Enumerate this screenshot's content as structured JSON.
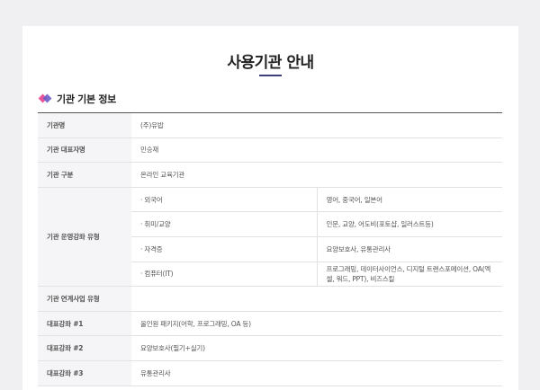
{
  "page": {
    "title": "사용기관 안내"
  },
  "section": {
    "title": "기관 기본 정보"
  },
  "rows": {
    "name": {
      "label": "기관명",
      "value": "(주)유밥"
    },
    "ceo": {
      "label": "기관 대표자명",
      "value": "민승재"
    },
    "type": {
      "label": "기관 구분",
      "value": "온라인 교육기관"
    },
    "course_types": {
      "label": "기관 운영강좌 유형",
      "items": [
        {
          "sub": "· 외국어",
          "value": "영어, 중국어, 일본어"
        },
        {
          "sub": "· 취미/교양",
          "value": "인문, 교양, 어도비(포토샵, 일러스트등)"
        },
        {
          "sub": "· 자격증",
          "value": "요양보호사, 유통관리사"
        },
        {
          "sub": "· 컴퓨터(IT)",
          "value": "프로그래밍, 데이터사이언스, 디지털 트랜스포메이션, OA(엑셀, 워드, PPT), 비즈스킬"
        }
      ]
    },
    "linked": {
      "label": "기관 연계사업 유형",
      "value": ""
    },
    "course1": {
      "label": "대표강좌 #1",
      "value": "올인원 패키지(어학, 프로그래밍, OA 등)"
    },
    "course2": {
      "label": "대표강좌 #2",
      "value": "요양보호사(필기+실기)"
    },
    "course3": {
      "label": "대표강좌 #3",
      "value": "유통관리사"
    }
  }
}
